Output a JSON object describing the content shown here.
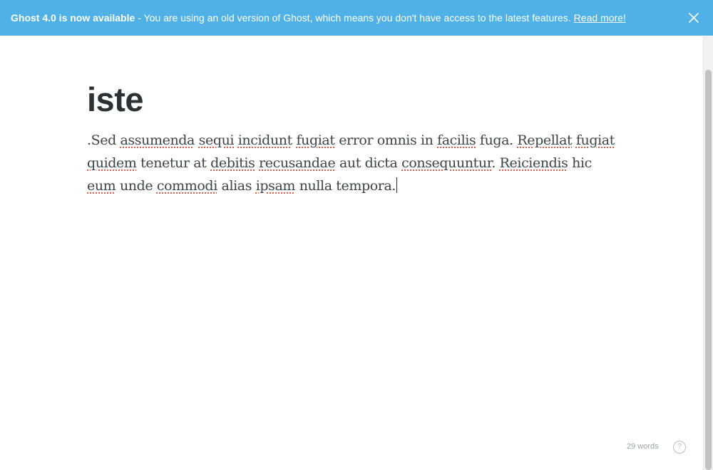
{
  "banner": {
    "headline": "Ghost 4.0 is now available",
    "message": "- You are using an old version of Ghost, which means you don't have access to the latest features.",
    "read_more": "Read more!",
    "close_icon": "close-icon",
    "background_color": "#4fb1e6"
  },
  "editor": {
    "title": "iste",
    "body_segments": [
      {
        "text": ".Sed ",
        "misspelled": false
      },
      {
        "text": "assumenda",
        "misspelled": true
      },
      {
        "text": " ",
        "misspelled": false
      },
      {
        "text": "sequi",
        "misspelled": true
      },
      {
        "text": " ",
        "misspelled": false
      },
      {
        "text": "incidunt",
        "misspelled": true
      },
      {
        "text": " ",
        "misspelled": false
      },
      {
        "text": "fugiat",
        "misspelled": true
      },
      {
        "text": " error omnis in ",
        "misspelled": false
      },
      {
        "text": "facilis",
        "misspelled": true
      },
      {
        "text": " fuga. ",
        "misspelled": false
      },
      {
        "text": "Repellat",
        "misspelled": true
      },
      {
        "text": " ",
        "misspelled": false
      },
      {
        "text": "fugiat",
        "misspelled": true
      },
      {
        "text": " ",
        "misspelled": false
      },
      {
        "text": "quidem",
        "misspelled": true
      },
      {
        "text": " tenetur at ",
        "misspelled": false
      },
      {
        "text": "debitis",
        "misspelled": true
      },
      {
        "text": " ",
        "misspelled": false
      },
      {
        "text": "recusandae",
        "misspelled": true
      },
      {
        "text": " aut dicta ",
        "misspelled": false
      },
      {
        "text": "consequuntur",
        "misspelled": true
      },
      {
        "text": ". ",
        "misspelled": false
      },
      {
        "text": "Reiciendis",
        "misspelled": true
      },
      {
        "text": " hic ",
        "misspelled": false
      },
      {
        "text": "eum",
        "misspelled": true
      },
      {
        "text": " unde ",
        "misspelled": false
      },
      {
        "text": "commodi",
        "misspelled": true
      },
      {
        "text": " alias ",
        "misspelled": false
      },
      {
        "text": "ipsam",
        "misspelled": true
      },
      {
        "text": " nulla tempora.",
        "misspelled": false
      }
    ],
    "spellcheck_color": "#e25440"
  },
  "footer": {
    "word_count": "29 words",
    "help_label": "?",
    "help_icon": "help-icon"
  }
}
